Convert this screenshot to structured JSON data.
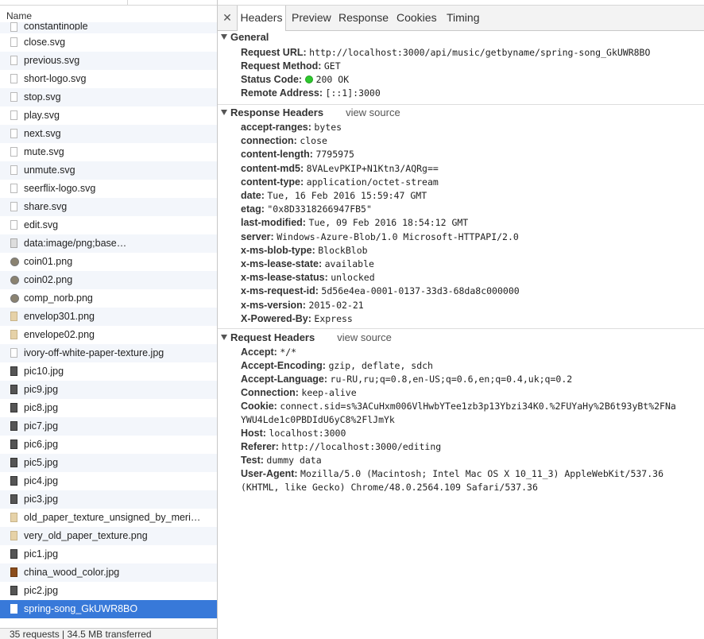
{
  "list": {
    "header": "Name",
    "items": [
      {
        "name": "constantinople",
        "icon": "file-icon"
      },
      {
        "name": "close.svg",
        "icon": "file-icon"
      },
      {
        "name": "previous.svg",
        "icon": "file-icon"
      },
      {
        "name": "short-logo.svg",
        "icon": "file-icon"
      },
      {
        "name": "stop.svg",
        "icon": "file-icon"
      },
      {
        "name": "play.svg",
        "icon": "file-icon"
      },
      {
        "name": "next.svg",
        "icon": "file-icon"
      },
      {
        "name": "mute.svg",
        "icon": "file-icon"
      },
      {
        "name": "unmute.svg",
        "icon": "file-icon"
      },
      {
        "name": "seerflix-logo.svg",
        "icon": "file-icon"
      },
      {
        "name": "share.svg",
        "icon": "file-icon"
      },
      {
        "name": "edit.svg",
        "icon": "file-icon"
      },
      {
        "name": "data:image/png;base…",
        "icon": "data-image-icon"
      },
      {
        "name": "coin01.png",
        "icon": "coin-image-icon"
      },
      {
        "name": "coin02.png",
        "icon": "coin-image-icon"
      },
      {
        "name": "comp_norb.png",
        "icon": "coin-image-icon"
      },
      {
        "name": "envelop301.png",
        "icon": "paper-image-icon"
      },
      {
        "name": "envelope02.png",
        "icon": "paper-image-icon"
      },
      {
        "name": "ivory-off-white-paper-texture.jpg",
        "icon": "file-icon"
      },
      {
        "name": "pic10.jpg",
        "icon": "photo-icon"
      },
      {
        "name": "pic9.jpg",
        "icon": "photo-icon"
      },
      {
        "name": "pic8.jpg",
        "icon": "photo-icon"
      },
      {
        "name": "pic7.jpg",
        "icon": "photo-icon"
      },
      {
        "name": "pic6.jpg",
        "icon": "photo-icon"
      },
      {
        "name": "pic5.jpg",
        "icon": "photo-icon"
      },
      {
        "name": "pic4.jpg",
        "icon": "photo-icon"
      },
      {
        "name": "pic3.jpg",
        "icon": "photo-icon"
      },
      {
        "name": "old_paper_texture_unsigned_by_meri…",
        "icon": "paper-image-icon"
      },
      {
        "name": "very_old_paper_texture.png",
        "icon": "paper-image-icon"
      },
      {
        "name": "pic1.jpg",
        "icon": "photo-icon"
      },
      {
        "name": "china_wood_color.jpg",
        "icon": "wood-image-icon"
      },
      {
        "name": "pic2.jpg",
        "icon": "photo-icon"
      },
      {
        "name": "spring-song_GkUWR8BO",
        "icon": "file-icon",
        "selected": true
      }
    ],
    "footer": "35 requests | 34.5 MB transferred"
  },
  "tabs": [
    "Headers",
    "Preview",
    "Response",
    "Cookies",
    "Timing"
  ],
  "active_tab": "Headers",
  "general": {
    "title": "General",
    "rows": [
      {
        "k": "Request URL:",
        "v": "http://localhost:3000/api/music/getbyname/spring-song_GkUWR8BO"
      },
      {
        "k": "Request Method:",
        "v": "GET"
      },
      {
        "k": "Status Code:",
        "v": "200 OK",
        "status_color": "#2ec82e"
      },
      {
        "k": "Remote Address:",
        "v": "[::1]:3000"
      }
    ]
  },
  "response_headers": {
    "title": "Response Headers",
    "view_source": "view source",
    "rows": [
      {
        "k": "accept-ranges:",
        "v": "bytes"
      },
      {
        "k": "connection:",
        "v": "close"
      },
      {
        "k": "content-length:",
        "v": "7795975"
      },
      {
        "k": "content-md5:",
        "v": "8VALevPKIP+N1Ktn3/AQRg=="
      },
      {
        "k": "content-type:",
        "v": "application/octet-stream"
      },
      {
        "k": "date:",
        "v": "Tue, 16 Feb 2016 15:59:47 GMT"
      },
      {
        "k": "etag:",
        "v": "\"0x8D3318266947FB5\""
      },
      {
        "k": "last-modified:",
        "v": "Tue, 09 Feb 2016 18:54:12 GMT"
      },
      {
        "k": "server:",
        "v": "Windows-Azure-Blob/1.0 Microsoft-HTTPAPI/2.0"
      },
      {
        "k": "x-ms-blob-type:",
        "v": "BlockBlob"
      },
      {
        "k": "x-ms-lease-state:",
        "v": "available"
      },
      {
        "k": "x-ms-lease-status:",
        "v": "unlocked"
      },
      {
        "k": "x-ms-request-id:",
        "v": "5d56e4ea-0001-0137-33d3-68da8c000000"
      },
      {
        "k": "x-ms-version:",
        "v": "2015-02-21"
      },
      {
        "k": "X-Powered-By:",
        "v": "Express"
      }
    ]
  },
  "request_headers": {
    "title": "Request Headers",
    "view_source": "view source",
    "rows": [
      {
        "k": "Accept:",
        "v": "*/*"
      },
      {
        "k": "Accept-Encoding:",
        "v": "gzip, deflate, sdch"
      },
      {
        "k": "Accept-Language:",
        "v": "ru-RU,ru;q=0.8,en-US;q=0.6,en;q=0.4,uk;q=0.2"
      },
      {
        "k": "Connection:",
        "v": "keep-alive"
      },
      {
        "k": "Cookie:",
        "v": "connect.sid=s%3ACuHxm006VlHwbYTee1zb3p13Ybzi34K0.%2FUYaHy%2B6t93yBt%2FNa",
        "v2": "YWU4Lde1c0PBDIdU6yC8%2FlJmYk"
      },
      {
        "k": "Host:",
        "v": "localhost:3000"
      },
      {
        "k": "Referer:",
        "v": "http://localhost:3000/editing"
      },
      {
        "k": "Test:",
        "v": "dummy data"
      },
      {
        "k": "User-Agent:",
        "v": "Mozilla/5.0 (Macintosh; Intel Mac OS X 10_11_3) AppleWebKit/537.36",
        "v2": "(KHTML, like Gecko) Chrome/48.0.2564.109 Safari/537.36"
      }
    ]
  }
}
